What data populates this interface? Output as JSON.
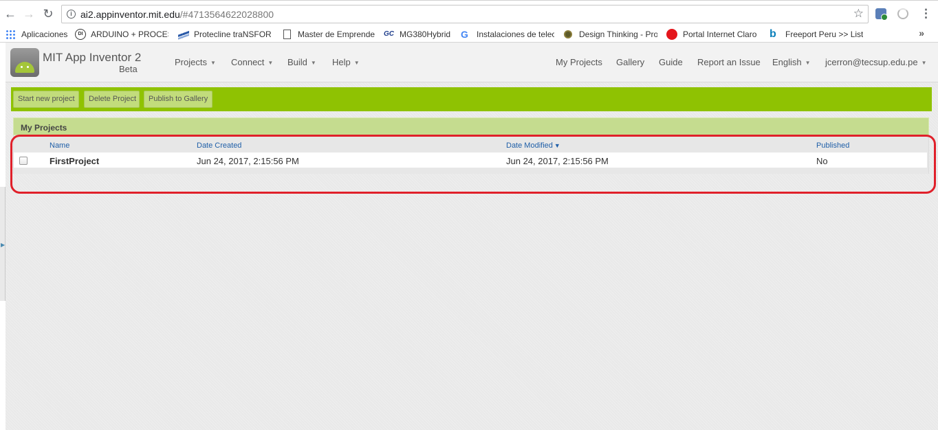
{
  "browser": {
    "url_host": "ai2.appinventor.mit.edu",
    "url_path": "/#4713564622028800",
    "bookmarks": [
      {
        "label": "Aplicaciones",
        "icon": "apps-grid-icon"
      },
      {
        "label": "ARDUINO + PROCES",
        "icon": "di-logo-icon"
      },
      {
        "label": "Protecline traNSFORM",
        "icon": "protecline-logo-icon"
      },
      {
        "label": "Master de Emprende",
        "icon": "page-icon"
      },
      {
        "label": "MG380Hybrid",
        "icon": "gc-logo-icon"
      },
      {
        "label": "Instalaciones de telec",
        "icon": "google-icon"
      },
      {
        "label": "Design Thinking - Pro",
        "icon": "dt-logo-icon"
      },
      {
        "label": "Portal Internet Claro",
        "icon": "claro-logo-icon"
      },
      {
        "label": "Freeport Peru >> List",
        "icon": "bing-icon"
      }
    ],
    "overflow_label": "»"
  },
  "app": {
    "title": "MIT App Inventor 2",
    "subtitle": "Beta",
    "menus": [
      {
        "label": "Projects"
      },
      {
        "label": "Connect"
      },
      {
        "label": "Build"
      },
      {
        "label": "Help"
      }
    ],
    "links": {
      "my_projects": "My Projects",
      "gallery": "Gallery",
      "guide": "Guide",
      "report": "Report an Issue",
      "language": "English",
      "account": "jcerron@tecsup.edu.pe"
    }
  },
  "toolbar": {
    "start_new": "Start new project",
    "delete": "Delete Project",
    "publish": "Publish to Gallery"
  },
  "projects": {
    "title": "My Projects",
    "columns": {
      "name": "Name",
      "created": "Date Created",
      "modified": "Date Modified",
      "published": "Published"
    },
    "sort_indicator": "▼",
    "rows": [
      {
        "name": "FirstProject",
        "created": "Jun 24, 2017, 2:15:56 PM",
        "modified": "Jun 24, 2017, 2:15:56 PM",
        "published": "No"
      }
    ]
  },
  "colors": {
    "toolbar_green": "#8fc202",
    "panel_header": "#c5dc8f",
    "link_blue": "#1f5fa8",
    "highlight_red": "#e0202a"
  }
}
